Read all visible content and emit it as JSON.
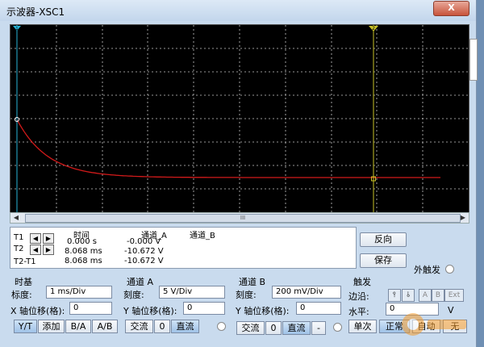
{
  "window": {
    "title": "示波器-XSC1",
    "close_glyph": "X"
  },
  "scope": {
    "marker_left": "1",
    "marker_right": "2",
    "scroll_label": "III"
  },
  "measurements": {
    "headers": {
      "time": "时间",
      "ch_a": "通道_A",
      "ch_b": "通道_B"
    },
    "rows": [
      {
        "label": "T1",
        "time": "0.000 s",
        "ch_a": "-0.000 V",
        "ch_b": ""
      },
      {
        "label": "T2",
        "time": "8.068 ms",
        "ch_a": "-10.672 V",
        "ch_b": ""
      },
      {
        "label": "T2-T1",
        "time": "8.068 ms",
        "ch_a": "-10.672 V",
        "ch_b": ""
      }
    ]
  },
  "actions": {
    "reverse": "反向",
    "save": "保存",
    "ext_trigger": "外触发"
  },
  "timebase": {
    "title": "时基",
    "scale_label": "标度:",
    "scale_value": "1 ms/Div",
    "xpos_label": "X 轴位移(格):",
    "xpos_value": "0",
    "buttons": [
      "Y/T",
      "添加",
      "B/A",
      "A/B"
    ]
  },
  "channel_a": {
    "title": "通道 A",
    "scale_label": "刻度:",
    "scale_value": "5  V/Div",
    "ypos_label": "Y 轴位移(格):",
    "ypos_value": "0",
    "buttons": [
      "交流",
      "0",
      "直流"
    ]
  },
  "channel_b": {
    "title": "通道 B",
    "scale_label": "刻度:",
    "scale_value": "200 mV/Div",
    "ypos_label": "Y 轴位移(格):",
    "ypos_value": "0",
    "buttons": [
      "交流",
      "0",
      "直流",
      "-"
    ]
  },
  "trigger": {
    "title": "触发",
    "edge_label": "边沿:",
    "edge_buttons": [
      "A",
      "B",
      "Ext"
    ],
    "level_label": "水平:",
    "level_value": "0",
    "level_unit": "V",
    "mode_buttons": [
      "单次",
      "正常",
      "自动",
      "无"
    ]
  },
  "colors": {
    "trace": "#d11a1a",
    "cursor1": "#27b3d6",
    "cursor2": "#c9c227",
    "grid": "#c8c8c8"
  }
}
